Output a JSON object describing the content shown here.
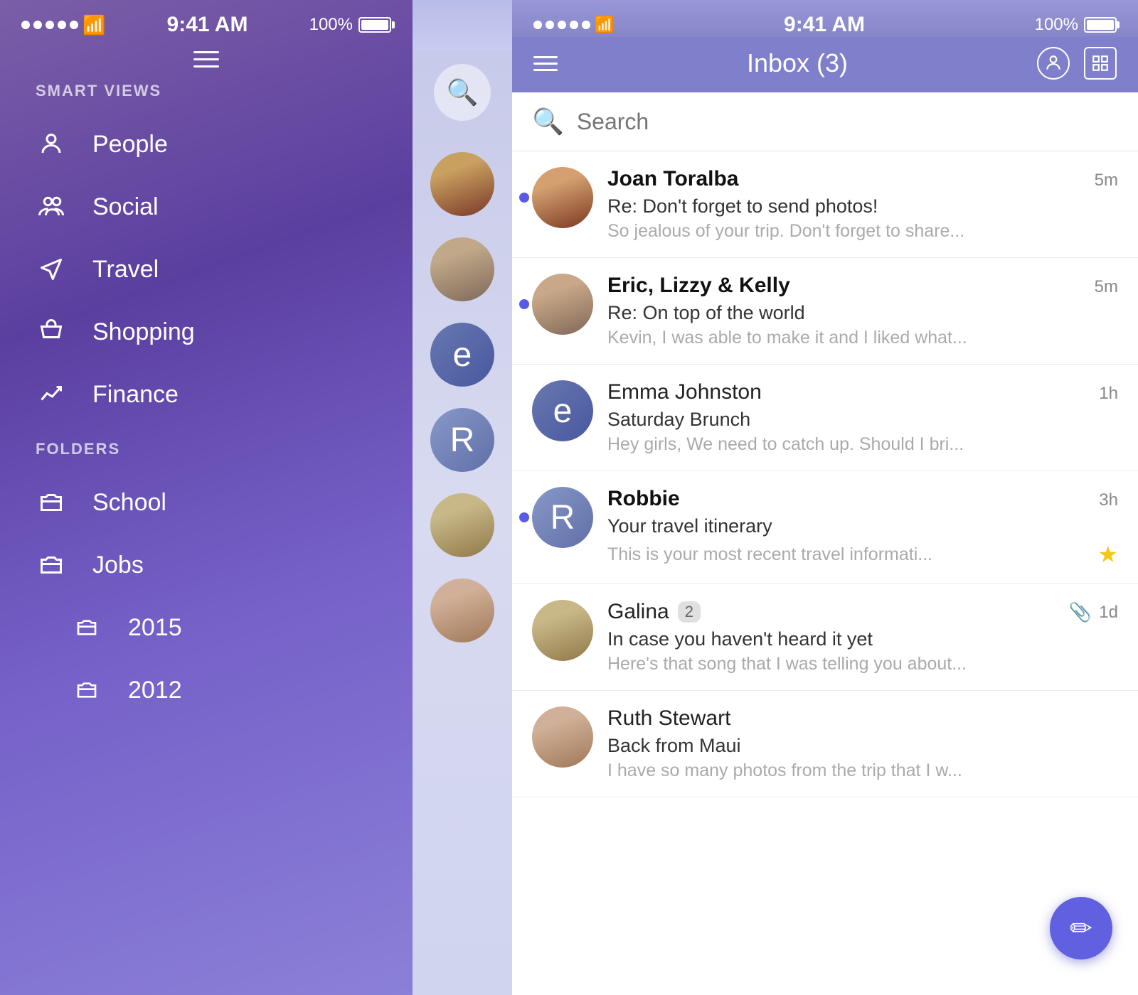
{
  "left_phone": {
    "status": {
      "time": "9:41 AM",
      "battery": "100%"
    },
    "smart_views_label": "SMART VIEWS",
    "nav_items": [
      {
        "id": "people",
        "label": "People"
      },
      {
        "id": "social",
        "label": "Social"
      },
      {
        "id": "travel",
        "label": "Travel"
      },
      {
        "id": "shopping",
        "label": "Shopping"
      },
      {
        "id": "finance",
        "label": "Finance"
      }
    ],
    "folders_label": "FOLDERS",
    "folder_items": [
      {
        "id": "school",
        "label": "School"
      },
      {
        "id": "jobs",
        "label": "Jobs"
      }
    ],
    "sub_folder_items": [
      {
        "id": "2015",
        "label": "2015"
      },
      {
        "id": "2012",
        "label": "2012"
      }
    ]
  },
  "right_phone": {
    "status": {
      "time": "9:41 AM",
      "battery": "100%"
    },
    "header": {
      "title": "Inbox (3)",
      "hamburger_label": "☰",
      "profile_label": "👤",
      "layout_label": "⊞"
    },
    "search": {
      "placeholder": "Search"
    },
    "emails": [
      {
        "id": "joan",
        "sender": "Joan Toralba",
        "unread": true,
        "time": "5m",
        "subject": "Re: Don't forget to send photos!",
        "preview": "So jealous of your trip. Don't forget to share...",
        "starred": false,
        "attached": false,
        "thread_count": null,
        "avatar_type": "face",
        "avatar_class": "face-joan"
      },
      {
        "id": "eric",
        "sender": "Eric, Lizzy & Kelly",
        "unread": true,
        "time": "5m",
        "subject": "Re: On top of the world",
        "preview": "Kevin, I was able to make it and I liked what...",
        "starred": false,
        "attached": false,
        "thread_count": null,
        "avatar_type": "face",
        "avatar_class": "face-eric"
      },
      {
        "id": "emma",
        "sender": "Emma Johnston",
        "unread": false,
        "time": "1h",
        "subject": "Saturday Brunch",
        "preview": "Hey girls, We need to catch up. Should I bri...",
        "starred": false,
        "attached": false,
        "thread_count": null,
        "avatar_type": "letter",
        "avatar_letter": "e",
        "avatar_class": "av-emma"
      },
      {
        "id": "robbie",
        "sender": "Robbie",
        "unread": true,
        "time": "3h",
        "subject": "Your travel itinerary",
        "preview": "This is your most recent travel informati...",
        "starred": true,
        "attached": false,
        "thread_count": null,
        "avatar_type": "letter",
        "avatar_letter": "R",
        "avatar_class": "av-robbie"
      },
      {
        "id": "galina",
        "sender": "Galina",
        "unread": false,
        "time": "1d",
        "subject": "In case you haven't heard it yet",
        "preview": "Here's that song that I was telling you about...",
        "starred": false,
        "attached": true,
        "thread_count": "2",
        "avatar_type": "face",
        "avatar_class": "face-galina"
      },
      {
        "id": "ruth",
        "sender": "Ruth Stewart",
        "unread": false,
        "time": "",
        "subject": "Back from Maui",
        "preview": "I have so many photos from the trip that I w...",
        "starred": false,
        "attached": false,
        "thread_count": null,
        "avatar_type": "face",
        "avatar_class": "face-ruth"
      }
    ],
    "compose_button_label": "✏"
  }
}
